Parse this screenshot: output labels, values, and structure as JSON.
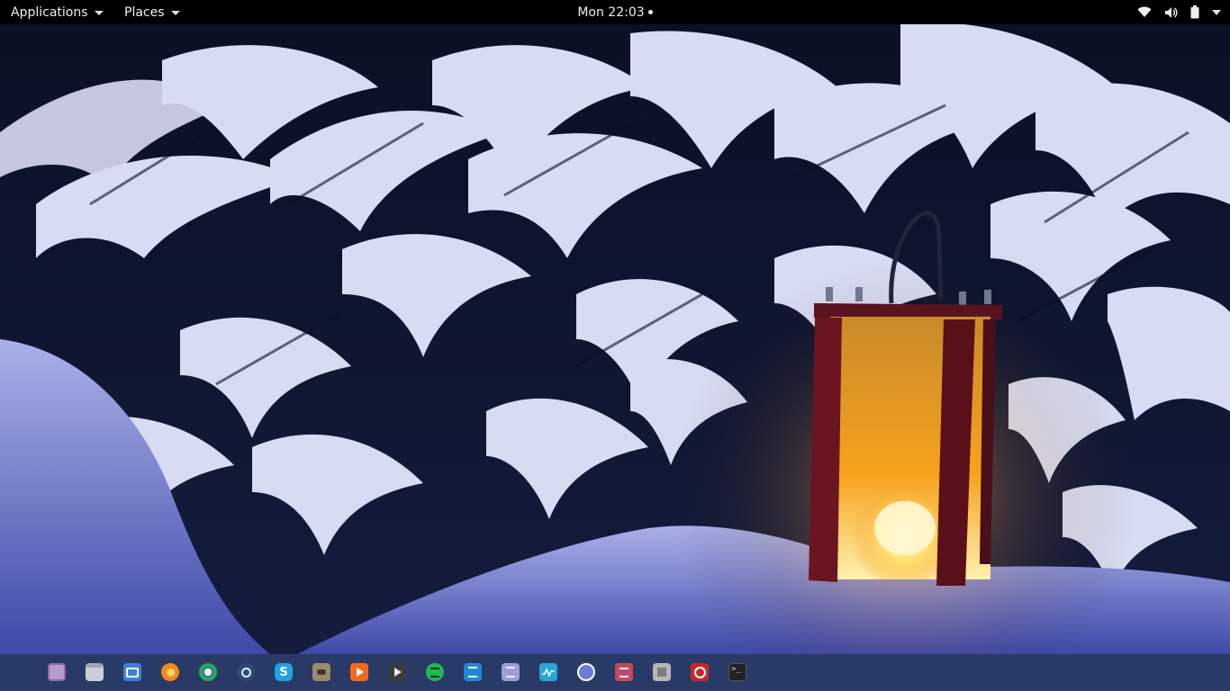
{
  "topbar": {
    "applications_label": "Applications",
    "places_label": "Places",
    "clock": "Mon 22:03"
  },
  "tray": {
    "icons": [
      "wifi-icon",
      "volume-icon",
      "battery-icon",
      "system-menu-caret-icon"
    ]
  },
  "wallpaper": {
    "description_icon": "snowy-spruce-lantern-wallpaper"
  },
  "dock": {
    "items": [
      {
        "name": "show-applications-icon",
        "color": "#d6d9e4"
      },
      {
        "name": "photo-viewer-icon",
        "color": "#b79ac9"
      },
      {
        "name": "files-icon",
        "color": "#c9cfd8"
      },
      {
        "name": "screenshot-icon",
        "color": "#3f7fd8"
      },
      {
        "name": "firefox-icon",
        "color": "#f08a1c"
      },
      {
        "name": "chrome-icon",
        "color": "#2fa94a"
      },
      {
        "name": "steam-icon",
        "color": "#2b4b78"
      },
      {
        "name": "skype-icon",
        "color": "#1ea3e4"
      },
      {
        "name": "gimp-icon",
        "color": "#9b8a6e"
      },
      {
        "name": "media-player-icon",
        "color": "#f26b1d"
      },
      {
        "name": "video-player-icon",
        "color": "#3a3a3a"
      },
      {
        "name": "spotify-icon",
        "color": "#1db954"
      },
      {
        "name": "text-editor-icon",
        "color": "#1e8ad6"
      },
      {
        "name": "notes-icon",
        "color": "#9aa0d8"
      },
      {
        "name": "system-monitor-icon",
        "color": "#27a7d8"
      },
      {
        "name": "app-grid-icon",
        "color": "#6c7bd8"
      },
      {
        "name": "settings-tweaks-icon",
        "color": "#c6495e"
      },
      {
        "name": "calculator-icon",
        "color": "#b7b7b7"
      },
      {
        "name": "update-manager-icon",
        "color": "#c62828"
      },
      {
        "name": "terminal-icon",
        "color": "#222"
      }
    ]
  }
}
